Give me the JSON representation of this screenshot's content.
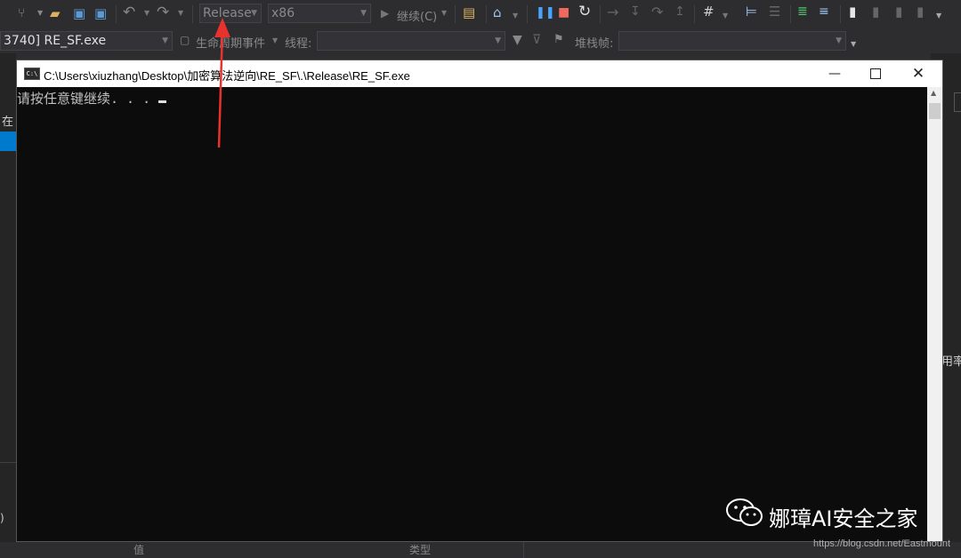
{
  "toolbar": {
    "config_combo": "Release",
    "platform_combo": "x86",
    "continue_label": "继续(C)"
  },
  "debug_bar": {
    "process_combo": "3740] RE_SF.exe",
    "lifecycle_label": "生命周期事件",
    "thread_label": "线程:",
    "stack_label": "堆栈帧:"
  },
  "left_panel": {
    "partial_text": "在"
  },
  "right_panel": {
    "partial_text": "用率"
  },
  "console": {
    "title": "C:\\Users\\xiuzhang\\Desktop\\加密算法逆向\\RE_SF\\.\\Release\\RE_SF.exe",
    "output": "请按任意键继续. . . ",
    "app_badge": "C:\\"
  },
  "bottom": {
    "col_value": "值",
    "col_type": "类型",
    "left_partial": ")"
  },
  "watermark": {
    "name": "娜璋AI安全之家",
    "url": "https://blog.csdn.net/Eastmount"
  },
  "annotation": {
    "arrow_color": "#e8322d"
  }
}
